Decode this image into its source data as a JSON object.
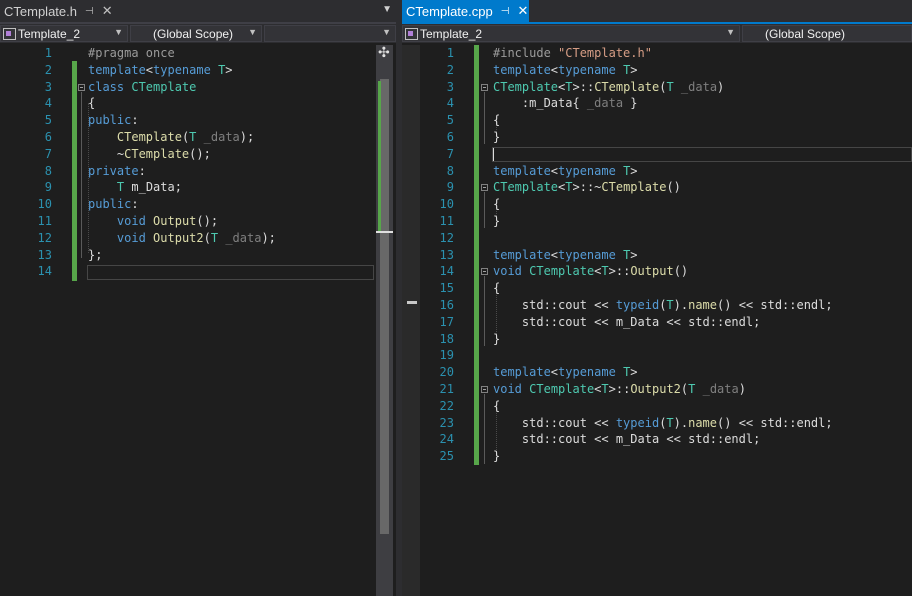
{
  "left": {
    "tab": {
      "title": "CTemplate.h",
      "pin": "⊣",
      "close": "✕"
    },
    "nav": {
      "project": "Template_2",
      "scope": "(Global Scope)",
      "member": ""
    },
    "lines": [
      {
        "n": "1",
        "html": "<span class='pp'>#pragma once</span>"
      },
      {
        "n": "2",
        "html": "<span class='kw'>template</span>&lt;<span class='kw'>typename</span> <span class='ty'>T</span>&gt;"
      },
      {
        "n": "3",
        "html": "<span class='kw'>class</span> <span class='ty'>CTemplate</span>"
      },
      {
        "n": "4",
        "html": "{"
      },
      {
        "n": "5",
        "html": "<span class='kw'>public</span>:"
      },
      {
        "n": "6",
        "html": "    <span class='fn'>CTemplate</span>(<span class='ty'>T</span> <span class='pa'>_data</span>);"
      },
      {
        "n": "7",
        "html": "    ~<span class='fn'>CTemplate</span>();"
      },
      {
        "n": "8",
        "html": "<span class='kw'>private</span>:"
      },
      {
        "n": "9",
        "html": "    <span class='ty'>T</span> m_Data;"
      },
      {
        "n": "10",
        "html": "<span class='kw'>public</span>:"
      },
      {
        "n": "11",
        "html": "    <span class='kw'>void</span> <span class='fn'>Output</span>();"
      },
      {
        "n": "12",
        "html": "    <span class='kw'>void</span> <span class='fn'>Output2</span>(<span class='ty'>T</span> <span class='pa'>_data</span>);"
      },
      {
        "n": "13",
        "html": "};"
      },
      {
        "n": "14",
        "html": ""
      }
    ]
  },
  "right": {
    "tab": {
      "title": "CTemplate.cpp",
      "pin": "⊣",
      "close": "✕"
    },
    "nav": {
      "project": "Template_2",
      "scope": "(Global Scope)"
    },
    "lines": [
      {
        "n": "1",
        "html": "<span class='pp'>#include</span> <span class='st'>\"CTemplate.h\"</span>"
      },
      {
        "n": "2",
        "html": "<span class='kw'>template</span>&lt;<span class='kw'>typename</span> <span class='ty'>T</span>&gt;"
      },
      {
        "n": "3",
        "html": "<span class='ty'>CTemplate</span>&lt;<span class='ty'>T</span>&gt;::<span class='fn'>CTemplate</span>(<span class='ty'>T</span> <span class='pa'>_data</span>)"
      },
      {
        "n": "4",
        "html": "    :m_Data{ <span class='pa'>_data</span> }"
      },
      {
        "n": "5",
        "html": "{"
      },
      {
        "n": "6",
        "html": "}"
      },
      {
        "n": "7",
        "html": ""
      },
      {
        "n": "8",
        "html": "<span class='kw'>template</span>&lt;<span class='kw'>typename</span> <span class='ty'>T</span>&gt;"
      },
      {
        "n": "9",
        "html": "<span class='ty'>CTemplate</span>&lt;<span class='ty'>T</span>&gt;::~<span class='fn'>CTemplate</span>()"
      },
      {
        "n": "10",
        "html": "{"
      },
      {
        "n": "11",
        "html": "}"
      },
      {
        "n": "12",
        "html": ""
      },
      {
        "n": "13",
        "html": "<span class='kw'>template</span>&lt;<span class='kw'>typename</span> <span class='ty'>T</span>&gt;"
      },
      {
        "n": "14",
        "html": "<span class='kw'>void</span> <span class='ty'>CTemplate</span>&lt;<span class='ty'>T</span>&gt;::<span class='fn'>Output</span>()"
      },
      {
        "n": "15",
        "html": "{"
      },
      {
        "n": "16",
        "html": "    std::cout &lt;&lt; <span class='kw'>typeid</span>(<span class='ty'>T</span>).<span class='fn'>name</span>() &lt;&lt; std::endl;"
      },
      {
        "n": "17",
        "html": "    std::cout &lt;&lt; m_Data &lt;&lt; std::endl;"
      },
      {
        "n": "18",
        "html": "}"
      },
      {
        "n": "19",
        "html": ""
      },
      {
        "n": "20",
        "html": "<span class='kw'>template</span>&lt;<span class='kw'>typename</span> <span class='ty'>T</span>&gt;"
      },
      {
        "n": "21",
        "html": "<span class='kw'>void</span> <span class='ty'>CTemplate</span>&lt;<span class='ty'>T</span>&gt;::<span class='fn'>Output2</span>(<span class='ty'>T</span> <span class='pa'>_data</span>)"
      },
      {
        "n": "22",
        "html": "{"
      },
      {
        "n": "23",
        "html": "    std::cout &lt;&lt; <span class='kw'>typeid</span>(<span class='ty'>T</span>).<span class='fn'>name</span>() &lt;&lt; std::endl;"
      },
      {
        "n": "24",
        "html": "    std::cout &lt;&lt; m_Data &lt;&lt; std::endl;"
      },
      {
        "n": "25",
        "html": "}"
      }
    ]
  },
  "colors": {
    "accent": "#007acc",
    "keyword": "#569cd6",
    "type": "#4ec9b0",
    "function": "#dcdcaa",
    "string": "#d69d85",
    "line_number": "#2b91af",
    "change_bar": "#57a64a"
  },
  "icons": [
    "pin-icon",
    "close-icon",
    "class-view-icon",
    "dropdown-arrow-icon",
    "split-icon"
  ]
}
